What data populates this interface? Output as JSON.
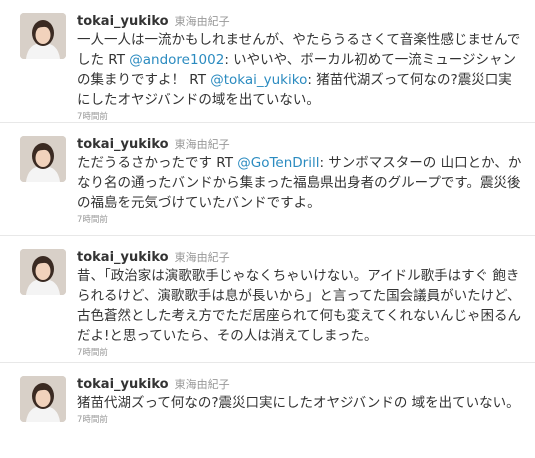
{
  "tweets": [
    {
      "screen_name": "tokai_yukiko",
      "full_name": "東海由紀子",
      "segments": [
        {
          "t": "一人一人は一流かもしれませんが、やたらうるさくて音楽性感じませんでした RT "
        },
        {
          "t": "@andore1002",
          "link": true
        },
        {
          "t": ": いやいや、ボーカル初めて一流ミュージシャンの集まりですよ！ RT "
        },
        {
          "t": "@tokai_yukiko",
          "link": true
        },
        {
          "t": ": 猪苗代湖ズって何なの?震災口実にしたオヤジバンドの域を出ていない。"
        }
      ],
      "time": "7時間前"
    },
    {
      "screen_name": "tokai_yukiko",
      "full_name": "東海由紀子",
      "segments": [
        {
          "t": "ただうるさかったです RT "
        },
        {
          "t": "@GoTenDrill",
          "link": true
        },
        {
          "t": ": サンボマスターの 山口とか、かなり名の通ったバンドから集まった福島県出身者のグループです。震災後の福島を元気づけていたバンドですよ。"
        }
      ],
      "time": "7時間前"
    },
    {
      "screen_name": "tokai_yukiko",
      "full_name": "東海由紀子",
      "segments": [
        {
          "t": "昔、「政治家は演歌歌手じゃなくちゃいけない。アイドル歌手はすぐ 飽きられるけど、演歌歌手は息が長いから」と言ってた国会議員がいたけど、古色蒼然とした考え方でただ居座られて何も変えてくれないんじゃ困るんだよ!と思っていたら、その人は消えてしまった。"
        }
      ],
      "time": "7時間前"
    },
    {
      "screen_name": "tokai_yukiko",
      "full_name": "東海由紀子",
      "segments": [
        {
          "t": "猪苗代湖ズって何なの?震災口実にしたオヤジバンドの 域を出ていない。"
        }
      ],
      "time": "7時間前"
    }
  ],
  "colors": {
    "link": "#2b8bc0",
    "meta": "#999999",
    "text": "#333333",
    "divider": "#e8e8e8"
  },
  "icons": {
    "avatar": "profile-photo"
  }
}
